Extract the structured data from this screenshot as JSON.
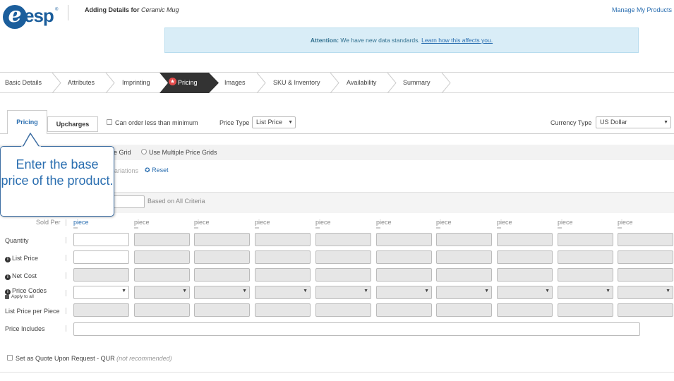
{
  "header": {
    "logo_text": "esp",
    "logo_letter": "e",
    "logo_mark": "®",
    "title_prefix": "Adding Details for",
    "title_product": "Ceramic Mug",
    "manage_link": "Manage My Products"
  },
  "attention": {
    "label": "Attention:",
    "message": "We have new data standards.",
    "link": "Learn how this affects you."
  },
  "steps": [
    {
      "label": "Basic Details"
    },
    {
      "label": "Attributes"
    },
    {
      "label": "Imprinting"
    },
    {
      "label": "Pricing",
      "active": true
    },
    {
      "label": "Images"
    },
    {
      "label": "SKU & Inventory"
    },
    {
      "label": "Availability"
    },
    {
      "label": "Summary"
    }
  ],
  "tabs": {
    "pricing": "Pricing",
    "upcharges": "Upcharges"
  },
  "options": {
    "can_order_less": "Can order less than minimum",
    "price_type_label": "Price Type",
    "price_type_value": "List Price",
    "currency_label": "Currency Type",
    "currency_value": "US Dollar",
    "single_grid_partial": "e Grid",
    "multiple_grids": "Use Multiple Price Grids",
    "variations_partial": "ariations",
    "reset": "Reset",
    "based_on": "Based on All Criteria"
  },
  "grid": {
    "sold_per_label": "Sold Per",
    "unit_first": "piece",
    "unit": "piece",
    "column_count": 10,
    "rows": {
      "quantity": "Quantity",
      "list_price": "List Price",
      "net_cost": "Net Cost",
      "price_codes": "Price Codes",
      "apply_to_all": "Apply to all",
      "list_price_per_piece": "List Price per Piece",
      "price_includes": "Price Includes"
    }
  },
  "qur": {
    "label": "Set as Quote Upon Request - QUR",
    "note": "(not recommended)"
  },
  "tooltip": {
    "text": "Enter the base price of the product."
  },
  "colors": {
    "brand": "#1b5e9c",
    "link": "#2a6eb0",
    "active_step": "#333333",
    "attention_bg": "#d9edf7"
  }
}
